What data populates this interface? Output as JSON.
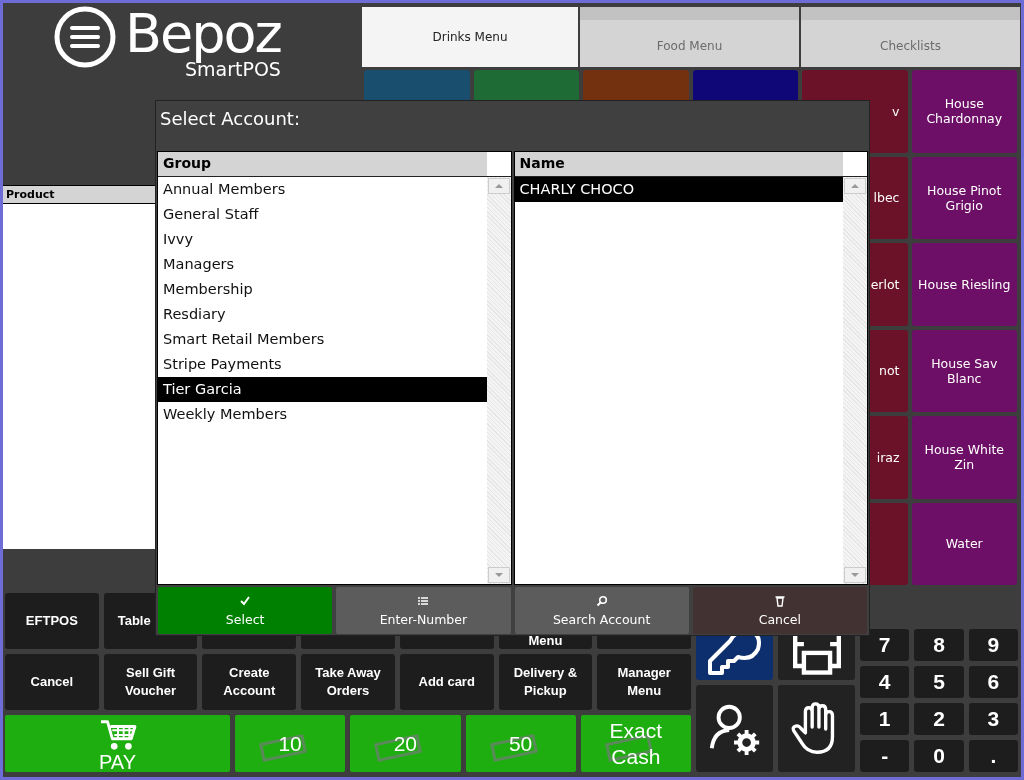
{
  "logo": {
    "brand": "Bepoz",
    "product": "SmartPOS"
  },
  "product_panel": {
    "header": "Product"
  },
  "tabs": [
    {
      "label": "Drinks Menu",
      "selected": true
    },
    {
      "label": "Food Menu",
      "selected": false
    },
    {
      "label": "Checklists",
      "selected": false
    }
  ],
  "tile_rows": [
    {
      "tiles": [
        {
          "color": "#1a4e6e"
        },
        {
          "color": "#1e6b35"
        },
        {
          "color": "#73310f"
        },
        {
          "color": "#0f0777"
        },
        {
          "color": "#6b1228",
          "label": "v"
        },
        {
          "color": "#6d0f66",
          "label": "House Chardonnay"
        }
      ]
    },
    {
      "tiles": [
        {
          "color": "#6b1228",
          "label": "lbec"
        },
        {
          "color": "#6d0f66",
          "label": "House Pinot Grigio"
        }
      ]
    },
    {
      "tiles": [
        {
          "color": "#6b1228",
          "label": "erlot"
        },
        {
          "color": "#6d0f66",
          "label": "House Riesling"
        }
      ]
    },
    {
      "tiles": [
        {
          "color": "#6b1228",
          "label": "not"
        },
        {
          "color": "#6d0f66",
          "label": "House Sav Blanc"
        }
      ]
    },
    {
      "tiles": [
        {
          "color": "#6b1228",
          "label": "iraz"
        },
        {
          "color": "#6d0f66",
          "label": "House White Zin"
        }
      ]
    },
    {
      "tiles": [
        {
          "color": "#6b1228"
        },
        {
          "color": "#6d0f66",
          "label": "Water"
        }
      ]
    }
  ],
  "function_rows": [
    [
      {
        "kind": "text",
        "label": "EFTPOS"
      },
      {
        "kind": "partial",
        "label": "Table"
      },
      {
        "kind": "blank"
      },
      {
        "kind": "blank"
      },
      {
        "kind": "blank"
      },
      {
        "kind": "tail",
        "label": "Menu"
      },
      {
        "kind": "blank"
      }
    ],
    [
      {
        "kind": "text",
        "label": "Cancel"
      },
      {
        "kind": "text",
        "label": "Sell Gift Voucher"
      },
      {
        "kind": "text",
        "label": "Create Account"
      },
      {
        "kind": "text",
        "label": "Take Away Orders"
      },
      {
        "kind": "text",
        "label": "Add card"
      },
      {
        "kind": "text",
        "label": "Delivery & Pickup"
      },
      {
        "kind": "text",
        "label": "Manager Menu"
      }
    ]
  ],
  "pay_row": [
    {
      "kind": "pay",
      "label": "PAY"
    },
    {
      "kind": "cash",
      "label": "10"
    },
    {
      "kind": "cash",
      "label": "20"
    },
    {
      "kind": "cash",
      "label": "50"
    },
    {
      "kind": "cash",
      "label": "Exact Cash"
    }
  ],
  "icon_tiles": [
    {
      "kind": "key"
    },
    {
      "kind": "printer"
    },
    {
      "kind": "user-settings"
    },
    {
      "kind": "hand"
    }
  ],
  "numpad": [
    "7",
    "8",
    "9",
    "4",
    "5",
    "6",
    "1",
    "2",
    "3",
    "-",
    "0",
    "."
  ],
  "dialog": {
    "title": "Select Account:",
    "group_list": {
      "header": "Group",
      "items": [
        {
          "label": "Annual Members",
          "selected": false
        },
        {
          "label": "General Staff",
          "selected": false
        },
        {
          "label": "Ivvy",
          "selected": false
        },
        {
          "label": "Managers",
          "selected": false
        },
        {
          "label": "Membership",
          "selected": false
        },
        {
          "label": "Resdiary",
          "selected": false
        },
        {
          "label": "Smart Retail Members",
          "selected": false
        },
        {
          "label": "Stripe Payments",
          "selected": false
        },
        {
          "label": "Tier Garcia",
          "selected": true
        },
        {
          "label": "Weekly Members",
          "selected": false
        }
      ]
    },
    "name_list": {
      "header": "Name",
      "items": [
        {
          "label": "CHARLY CHOCO",
          "selected": true
        }
      ]
    },
    "buttons": [
      {
        "kind": "select",
        "label": "Select"
      },
      {
        "kind": "enter-number",
        "label": "Enter-Number"
      },
      {
        "kind": "search",
        "label": "Search Account"
      },
      {
        "kind": "cancel",
        "label": "Cancel"
      }
    ]
  }
}
